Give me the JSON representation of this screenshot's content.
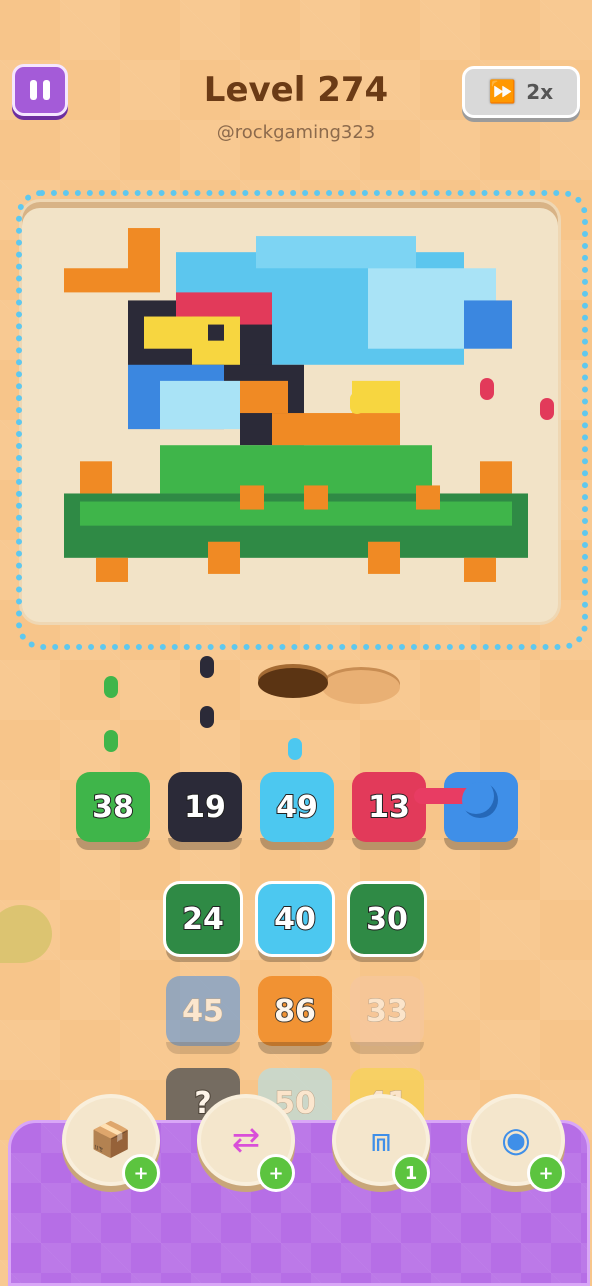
{
  "header": {
    "level_title": "Level 274",
    "username": "@rockgaming323",
    "speed_label": "2x"
  },
  "queue_tiles": [
    {
      "value": "38",
      "color": "#3fb54a"
    },
    {
      "value": "19",
      "color": "#2b2a38"
    },
    {
      "value": "49",
      "color": "#4cc8f0"
    },
    {
      "value": "13",
      "color": "#e23a5a"
    }
  ],
  "grid_tiles": [
    [
      {
        "value": "24",
        "color": "#2f8a45"
      },
      {
        "value": "40",
        "color": "#4cc8f0"
      },
      {
        "value": "30",
        "color": "#2f8a45"
      }
    ],
    [
      {
        "value": "45",
        "color": "#4a90e2"
      },
      {
        "value": "86",
        "color": "#f08a24"
      },
      {
        "value": "33",
        "color": "#f6c7a3"
      }
    ],
    [
      {
        "value": "?",
        "color": "#555555"
      },
      {
        "value": "50",
        "color": "#a8e4f7"
      },
      {
        "value": "41",
        "color": "#f7d640"
      }
    ]
  ],
  "boosters": [
    {
      "name": "add-slot-booster",
      "icon": "add-box-icon",
      "badge": "+"
    },
    {
      "name": "swap-booster",
      "icon": "arrows-swap-icon",
      "badge": "+"
    },
    {
      "name": "magnet-booster",
      "icon": "magnet-claw-icon",
      "badge": "1"
    },
    {
      "name": "cannon-booster",
      "icon": "cannon-icon",
      "badge": "+"
    }
  ]
}
